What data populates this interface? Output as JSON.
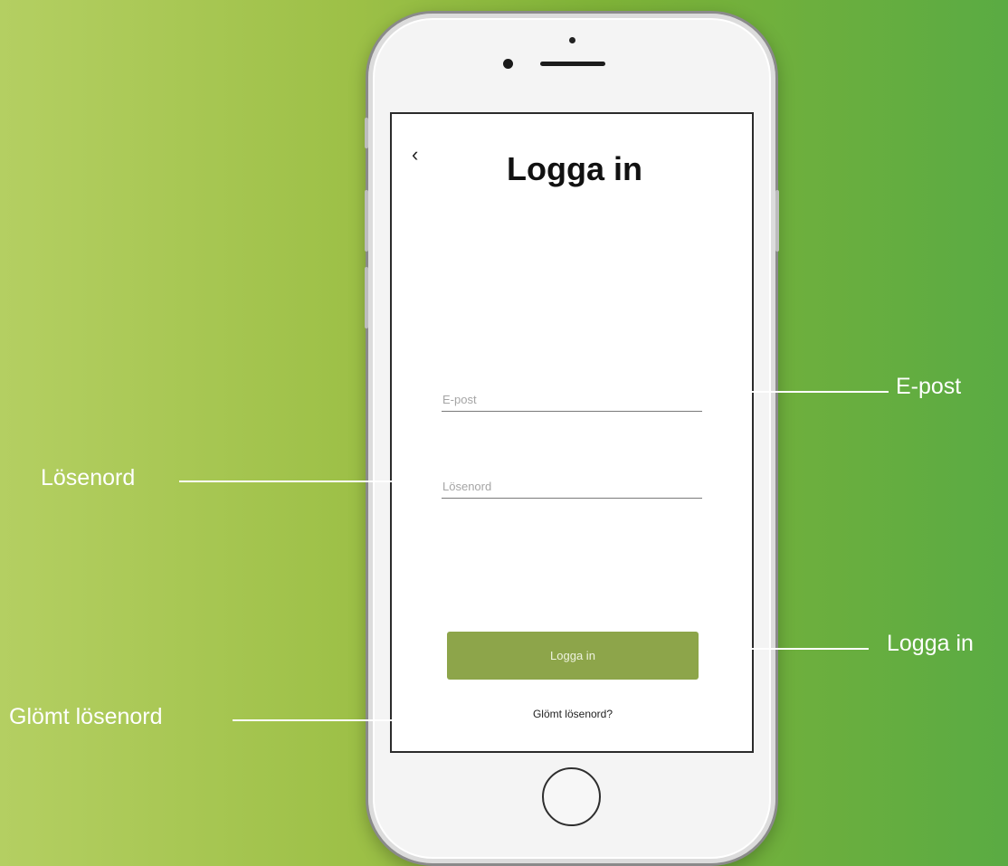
{
  "screen": {
    "title": "Logga in",
    "back_icon": "‹",
    "email_placeholder": "E-post",
    "password_placeholder": "Lösenord",
    "login_button": "Logga in",
    "forgot_link": "Glömt lösenord?"
  },
  "callouts": {
    "email": "E-post",
    "password": "Lösenord",
    "login": "Logga in",
    "forgot": "Glömt lösenord"
  },
  "colors": {
    "button": "#8da54a",
    "background_left": "#b4cf62",
    "background_right": "#5aab43"
  }
}
